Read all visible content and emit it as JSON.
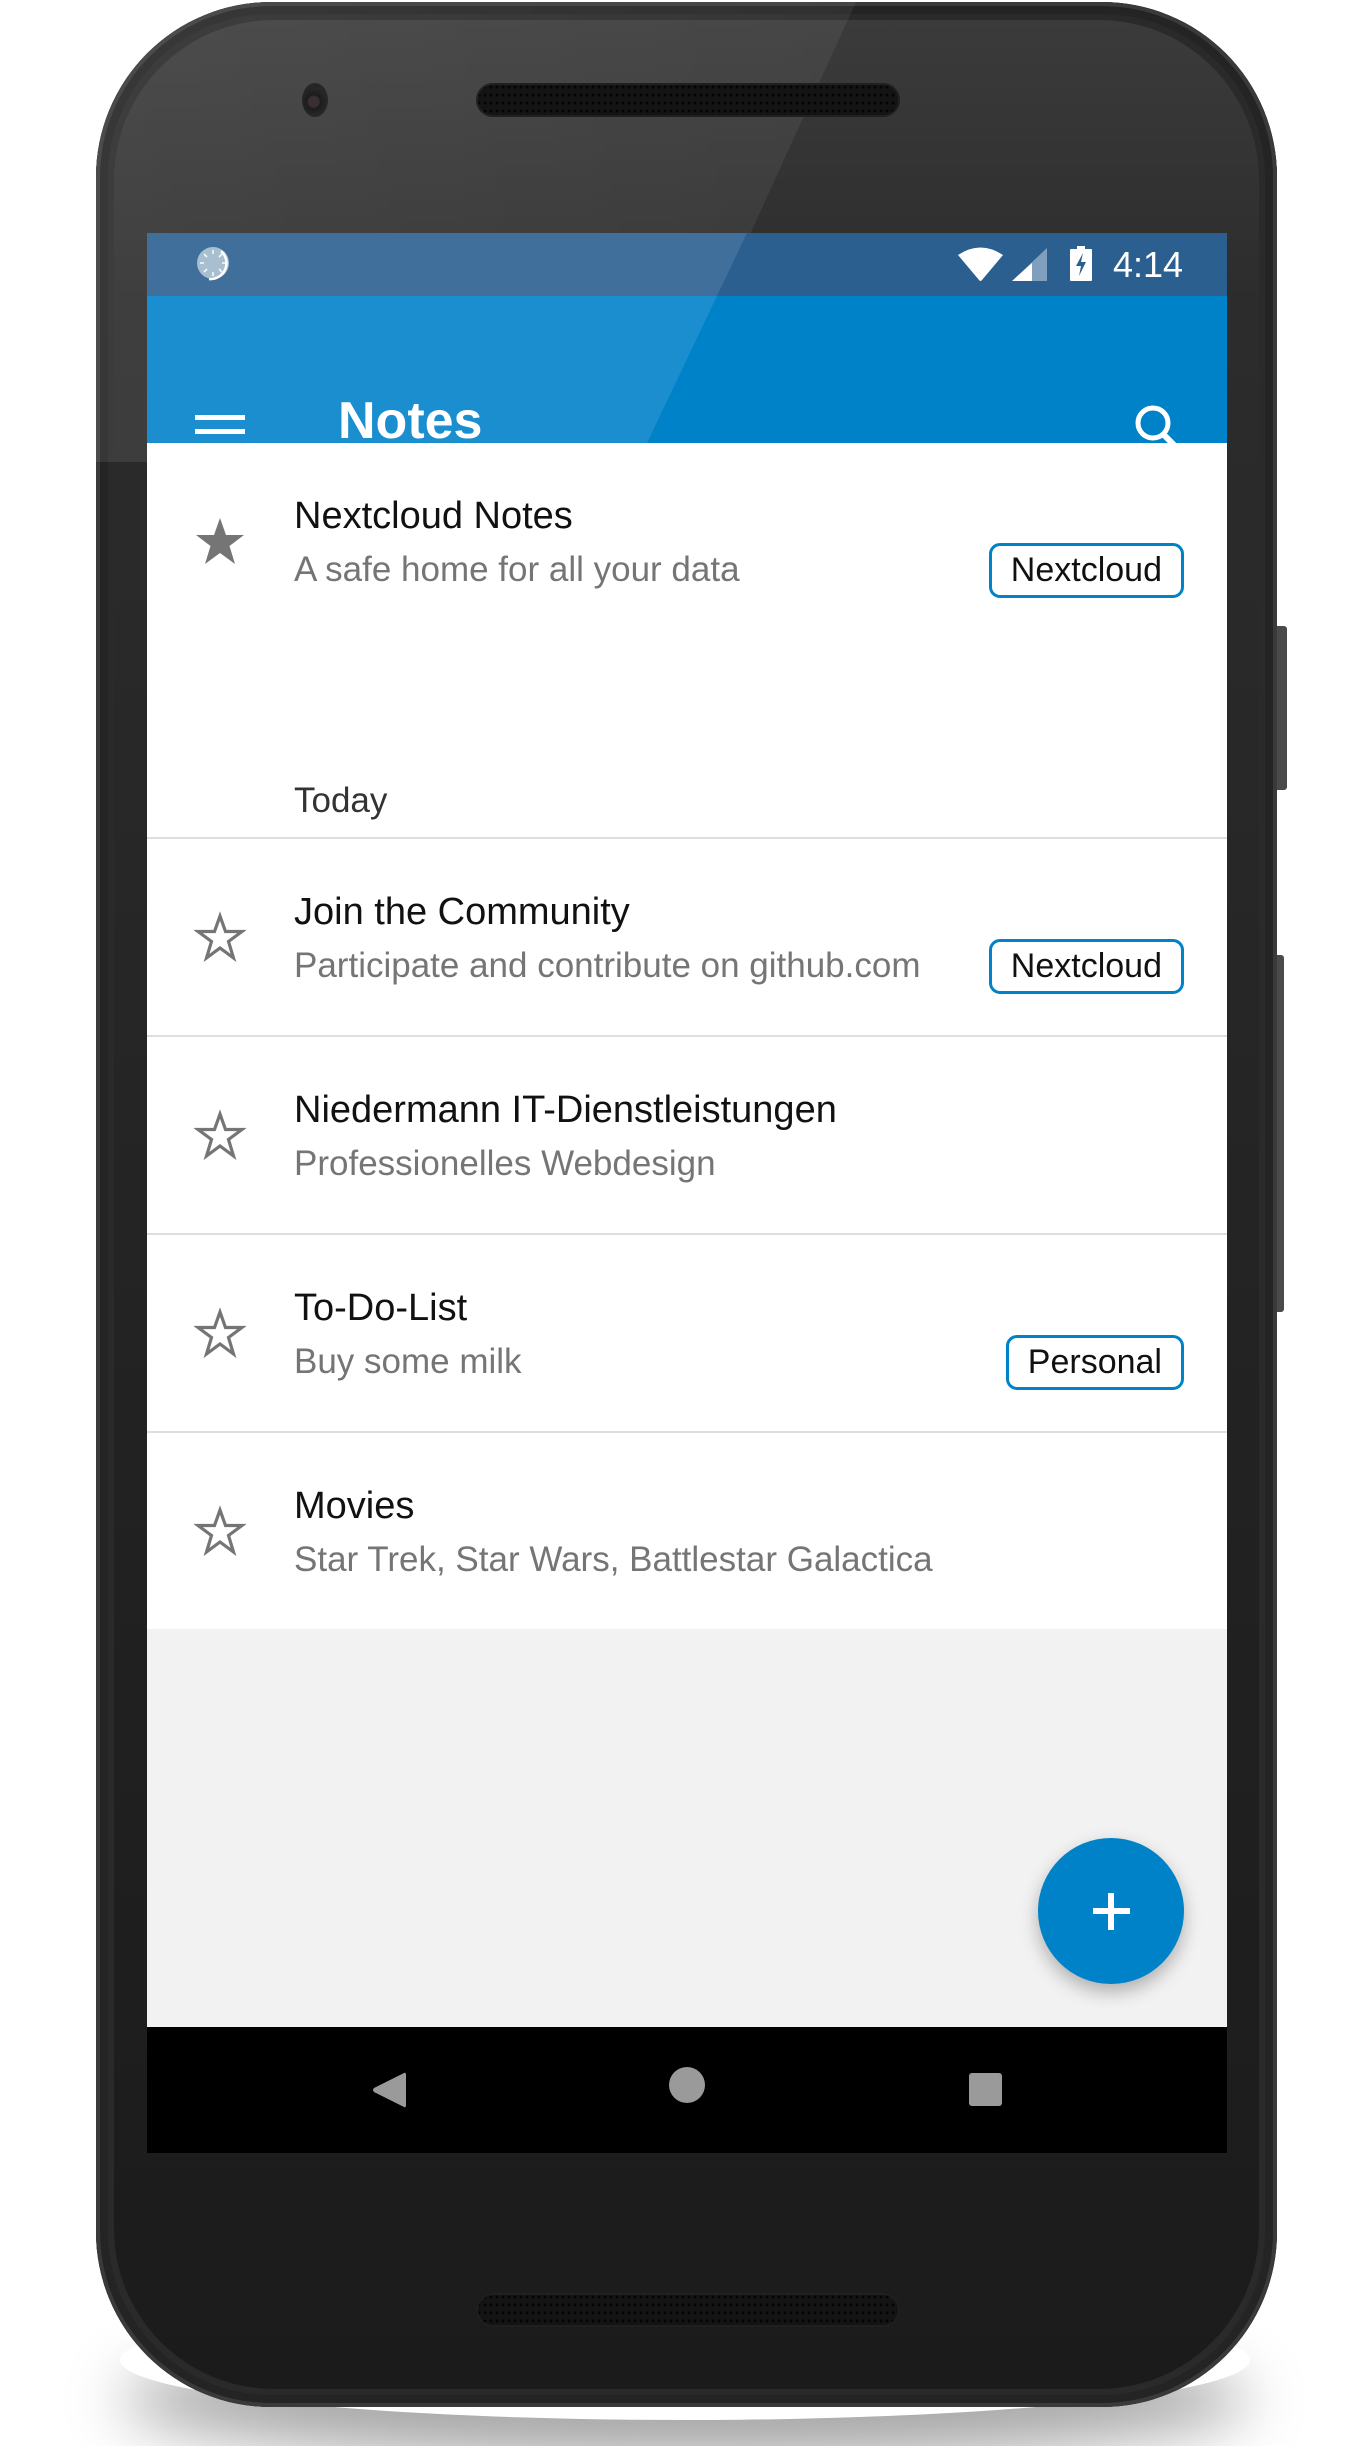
{
  "status_bar": {
    "time": "4:14",
    "icons": [
      "sync-icon",
      "wifi-icon",
      "signal-icon",
      "battery-charging-icon"
    ]
  },
  "app_bar": {
    "title": "Notes",
    "menu_icon": "hamburger-menu-icon",
    "search_icon": "search-icon"
  },
  "colors": {
    "accent": "#0082c9",
    "status_bar": "#2a5f8f",
    "star": "#757575",
    "divider": "#dedede",
    "background": "#f2f2f2"
  },
  "favorites": [
    {
      "title": "Nextcloud Notes",
      "subtitle": "A safe home for all your data",
      "category": "Nextcloud",
      "favorite": true
    }
  ],
  "groups": [
    {
      "label": "Today",
      "notes": [
        {
          "title": "Join the Community",
          "subtitle": "Participate and contribute on github.com",
          "category": "Nextcloud",
          "favorite": false
        },
        {
          "title": "Niedermann IT-Dienstleistungen",
          "subtitle": "Professionelles Webdesign",
          "category": "",
          "favorite": false
        },
        {
          "title": "To-Do-List",
          "subtitle": "Buy some milk",
          "category": "Personal",
          "favorite": false
        },
        {
          "title": "Movies",
          "subtitle": "Star Trek, Star Wars, Battlestar Galactica",
          "category": "",
          "favorite": false
        }
      ]
    }
  ],
  "fab": {
    "icon": "plus-icon",
    "label": "+"
  },
  "nav_bar": {
    "icons": [
      "back-icon",
      "home-icon",
      "recents-icon"
    ]
  }
}
